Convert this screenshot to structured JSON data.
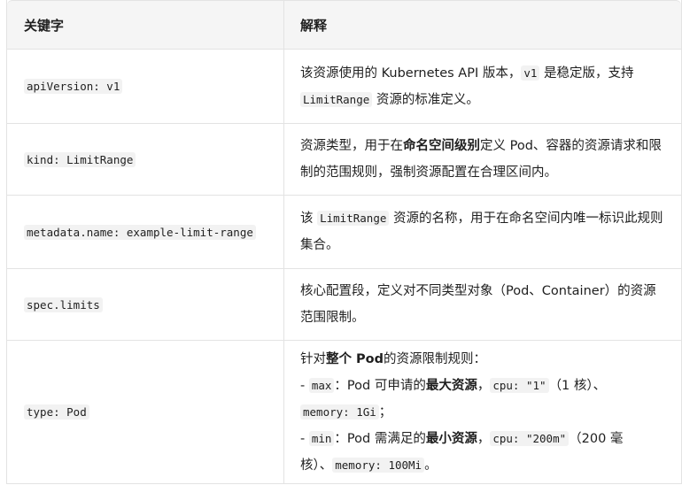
{
  "header": {
    "key": "关键字",
    "desc": "解释"
  },
  "rows": [
    {
      "key": "apiVersion: v1",
      "desc": {
        "a": "该资源使用的 Kubernetes API 版本，",
        "code1": "v1",
        "b": " 是稳定版，支持",
        "code2": "LimitRange",
        "c": " 资源的标准定义。"
      }
    },
    {
      "key": "kind: LimitRange",
      "desc": {
        "a": "资源类型，用于在",
        "bold": "命名空间级别",
        "b": "定义 Pod、容器的资源请求和限制的范围规则，强制资源配置在合理区间内。"
      }
    },
    {
      "key": "metadata.name: example-limit-range",
      "desc": {
        "a": "该 ",
        "code1": "LimitRange",
        "b": " 资源的名称，用于在命名空间内唯一标识此规则集合。"
      }
    },
    {
      "key": "spec.limits",
      "desc": {
        "a": "核心配置段，定义对不同类型对象（Pod、Container）的资源范围限制。"
      }
    },
    {
      "key": "type: Pod",
      "desc": {
        "l1a": "针对",
        "l1bold": "整个 Pod",
        "l1b": "的资源限制规则：",
        "l2a": "- ",
        "l2code": "max",
        "l2b": "：Pod 可申请的",
        "l2bold": "最大资源",
        "l2c": "，",
        "l2code2": "cpu: \"1\"",
        "l2d": "（1 核）、",
        "l3code": "memory: 1Gi",
        "l3a": "；",
        "l4a": "- ",
        "l4code": "min",
        "l4b": "：Pod 需满足的",
        "l4bold": "最小资源",
        "l4c": "，",
        "l4code2": "cpu: \"200m\"",
        "l4d": "（200 毫",
        "l5a": "核）、",
        "l5code": "memory: 100Mi",
        "l5b": "。"
      }
    }
  ]
}
